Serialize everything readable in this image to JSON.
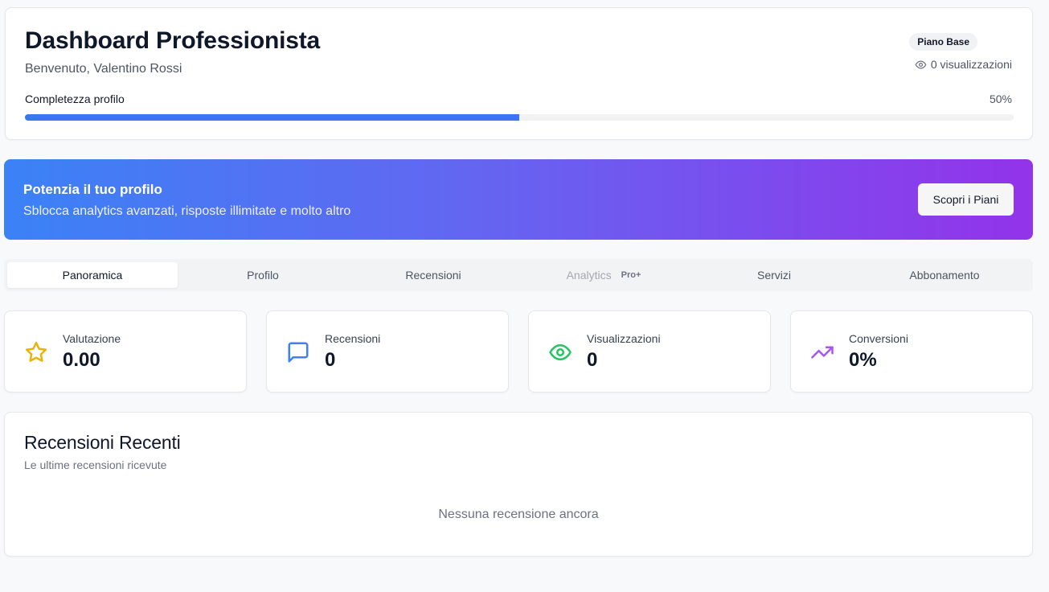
{
  "header": {
    "title": "Dashboard Professionista",
    "welcome": "Benvenuto, Valentino Rossi",
    "plan_badge": "Piano Base",
    "views": "0 visualizzazioni",
    "progress_label": "Completezza profilo",
    "progress_value_text": "50%",
    "progress_fraction": 0.5,
    "progress_color": "#3b76f0"
  },
  "promo": {
    "title": "Potenzia il tuo profilo",
    "subtitle": "Sblocca analytics avanzati, risposte illimitate e molto altro",
    "button": "Scopri i Piani",
    "gradient": [
      "#3b82f6",
      "#6366f1",
      "#9333ea"
    ]
  },
  "tabs": [
    {
      "label": "Panoramica",
      "active": true
    },
    {
      "label": "Profilo"
    },
    {
      "label": "Recensioni"
    },
    {
      "label": "Analytics",
      "badge": "Pro+",
      "disabled": true
    },
    {
      "label": "Servizi"
    },
    {
      "label": "Abbonamento"
    }
  ],
  "stats": [
    {
      "label": "Valutazione",
      "value": "0.00",
      "icon": "star-icon",
      "color": "#eab308"
    },
    {
      "label": "Recensioni",
      "value": "0",
      "icon": "message-icon",
      "color": "#3b82f6"
    },
    {
      "label": "Visualizzazioni",
      "value": "0",
      "icon": "eye-icon",
      "color": "#22c55e"
    },
    {
      "label": "Conversioni",
      "value": "0%",
      "icon": "trending-up-icon",
      "color": "#a855f7"
    }
  ],
  "reviews": {
    "title": "Recensioni Recenti",
    "subtitle": "Le ultime recensioni ricevute",
    "empty": "Nessuna recensione ancora"
  }
}
